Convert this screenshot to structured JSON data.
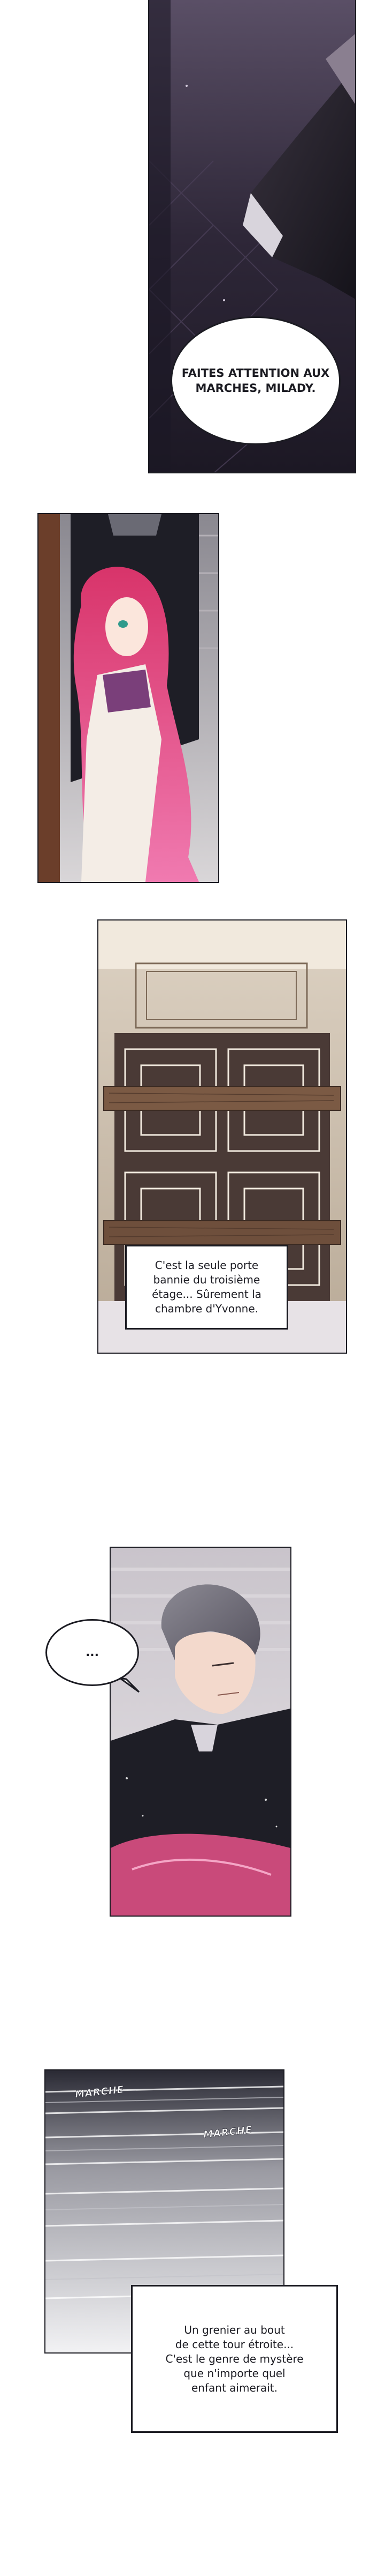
{
  "panel1": {
    "speech": "FAITES ATTENTION AUX\nMARCHES, MILADY."
  },
  "panel3": {
    "caption": "C'est la seule porte\nbannie du troisième\nétage... Sûrement la\nchambre d'Yvonne."
  },
  "panel4": {
    "speech": "..."
  },
  "panel5": {
    "sfx_1": "MARCHE",
    "sfx_2": "MARCHE",
    "caption": "Un grenier au bout\nde cette tour étroite...\nC'est le genre de mystère\nque n'importe quel\nenfant aimerait."
  },
  "colors": {
    "ink": "#1b1b22",
    "hair": "#d8346a",
    "rug": "#c94a7a"
  }
}
